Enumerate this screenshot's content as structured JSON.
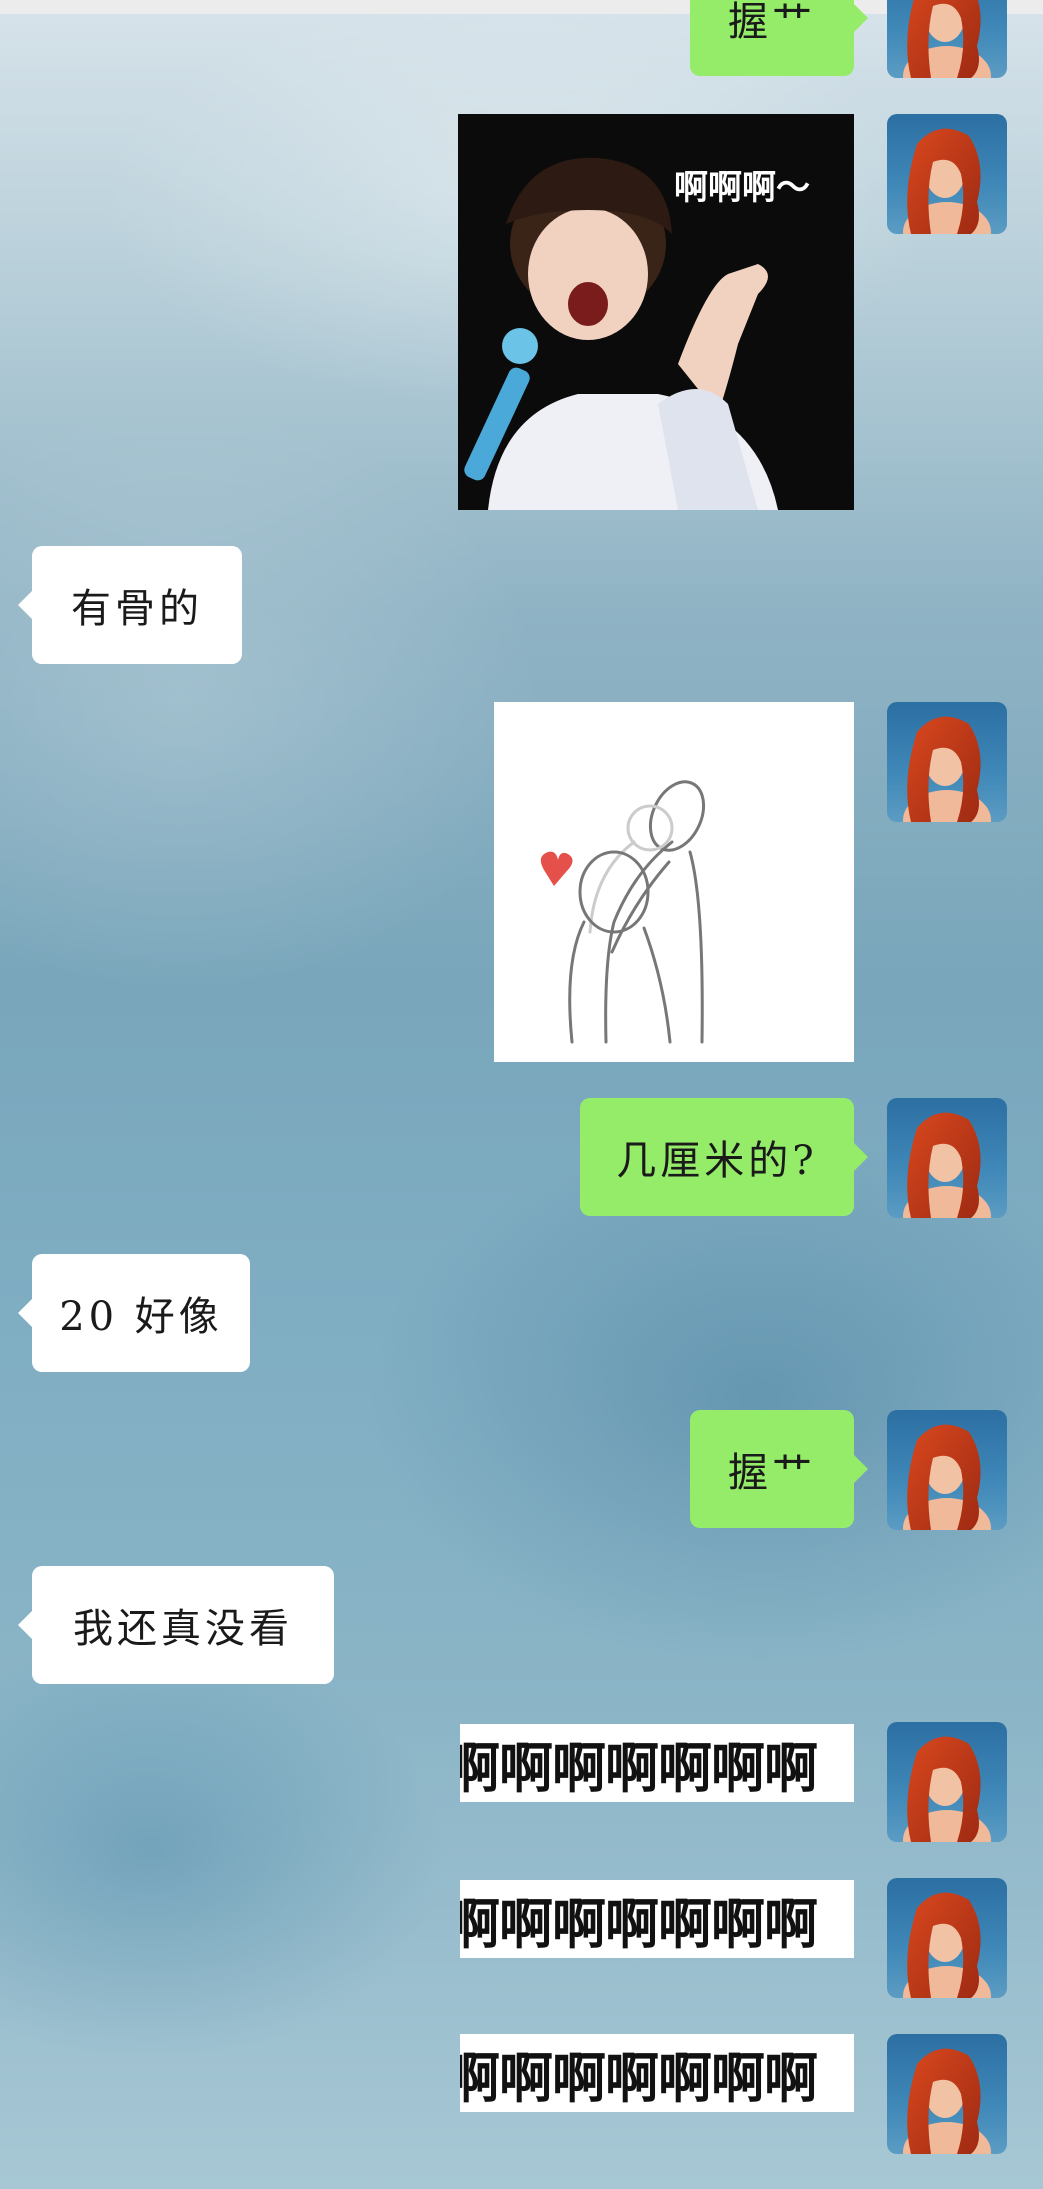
{
  "messages": [
    {
      "side": "out",
      "type": "text",
      "text": "握艹"
    },
    {
      "side": "out",
      "type": "image",
      "caption": "啊啊啊～"
    },
    {
      "side": "in",
      "type": "text",
      "text": "有骨的"
    },
    {
      "side": "out",
      "type": "image"
    },
    {
      "side": "out",
      "type": "text",
      "text": "几厘米的?"
    },
    {
      "side": "in",
      "type": "text",
      "text": "20 好像"
    },
    {
      "side": "out",
      "type": "text",
      "text": "握艹"
    },
    {
      "side": "in",
      "type": "text",
      "text": "我还真没看"
    },
    {
      "side": "out",
      "type": "sticker",
      "text": "啊啊啊啊啊啊啊"
    },
    {
      "side": "out",
      "type": "sticker",
      "text": "啊啊啊啊啊啊啊"
    },
    {
      "side": "out",
      "type": "sticker",
      "text": "啊啊啊啊啊啊啊"
    }
  ],
  "colors": {
    "outgoing_bubble": "#95ec69",
    "incoming_bubble": "#ffffff"
  },
  "icons": {
    "avatar": "red-haired-mermaid-avatar",
    "image1": "singer-with-microphone-photo",
    "image2": "hug-sketch-with-heart"
  }
}
